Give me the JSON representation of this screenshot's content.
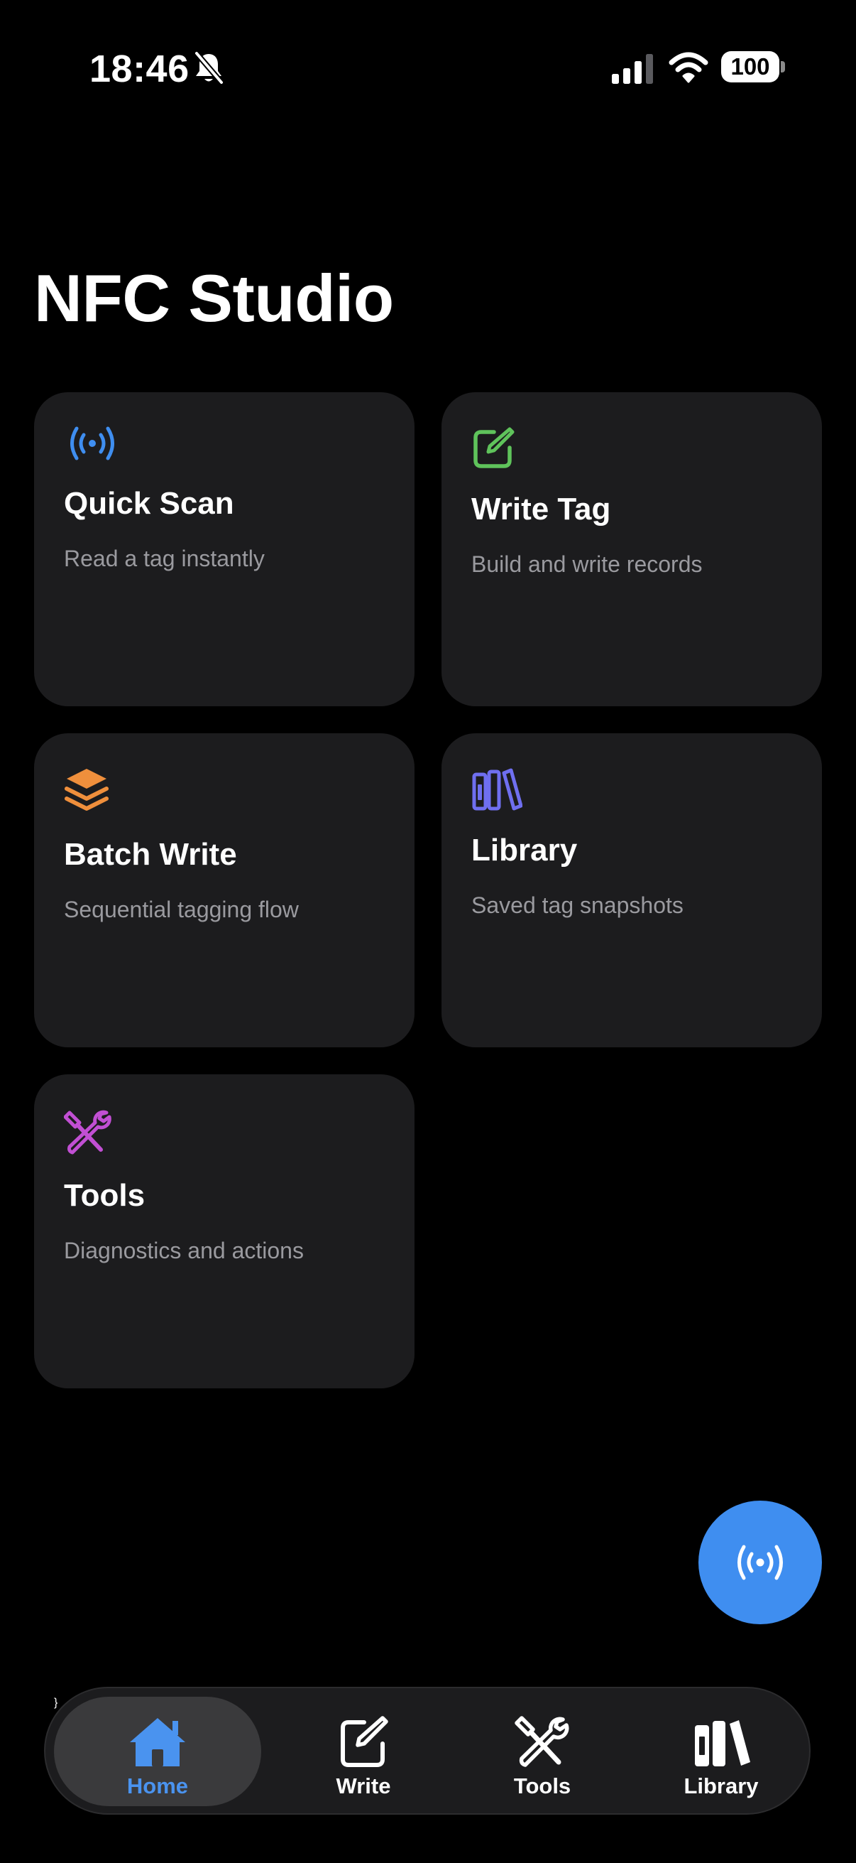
{
  "status_bar": {
    "time": "18:46",
    "battery": "100",
    "icons": [
      "bell-off-icon",
      "cellular-signal-icon",
      "wifi-icon",
      "battery-icon"
    ]
  },
  "page": {
    "title": "NFC Studio"
  },
  "cards": [
    {
      "title": "Quick Scan",
      "subtitle": "Read a tag instantly",
      "icon": "nfc-waves-icon",
      "icon_color": "#3f8ef0"
    },
    {
      "title": "Write Tag",
      "subtitle": "Build and write records",
      "icon": "edit-square-icon",
      "icon_color": "#5fc35b"
    },
    {
      "title": "Batch Write",
      "subtitle": "Sequential tagging flow",
      "icon": "layers-icon",
      "icon_color": "#ef8f3c"
    },
    {
      "title": "Library",
      "subtitle": "Saved tag snapshots",
      "icon": "books-icon",
      "icon_color": "#6f6ff0"
    },
    {
      "title": "Tools",
      "subtitle": "Diagnostics and actions",
      "icon": "tools-icon",
      "icon_color": "#c14fd3"
    }
  ],
  "fab": {
    "icon": "nfc-waves-icon",
    "color": "#3f8ef0"
  },
  "tab_bar": {
    "active_color": "#4a93ef",
    "items": [
      {
        "label": "Home",
        "icon": "house-icon",
        "active": true
      },
      {
        "label": "Write",
        "icon": "edit-square-icon",
        "active": false
      },
      {
        "label": "Tools",
        "icon": "tools-icon",
        "active": false
      },
      {
        "label": "Library",
        "icon": "books-icon",
        "active": false
      }
    ]
  }
}
